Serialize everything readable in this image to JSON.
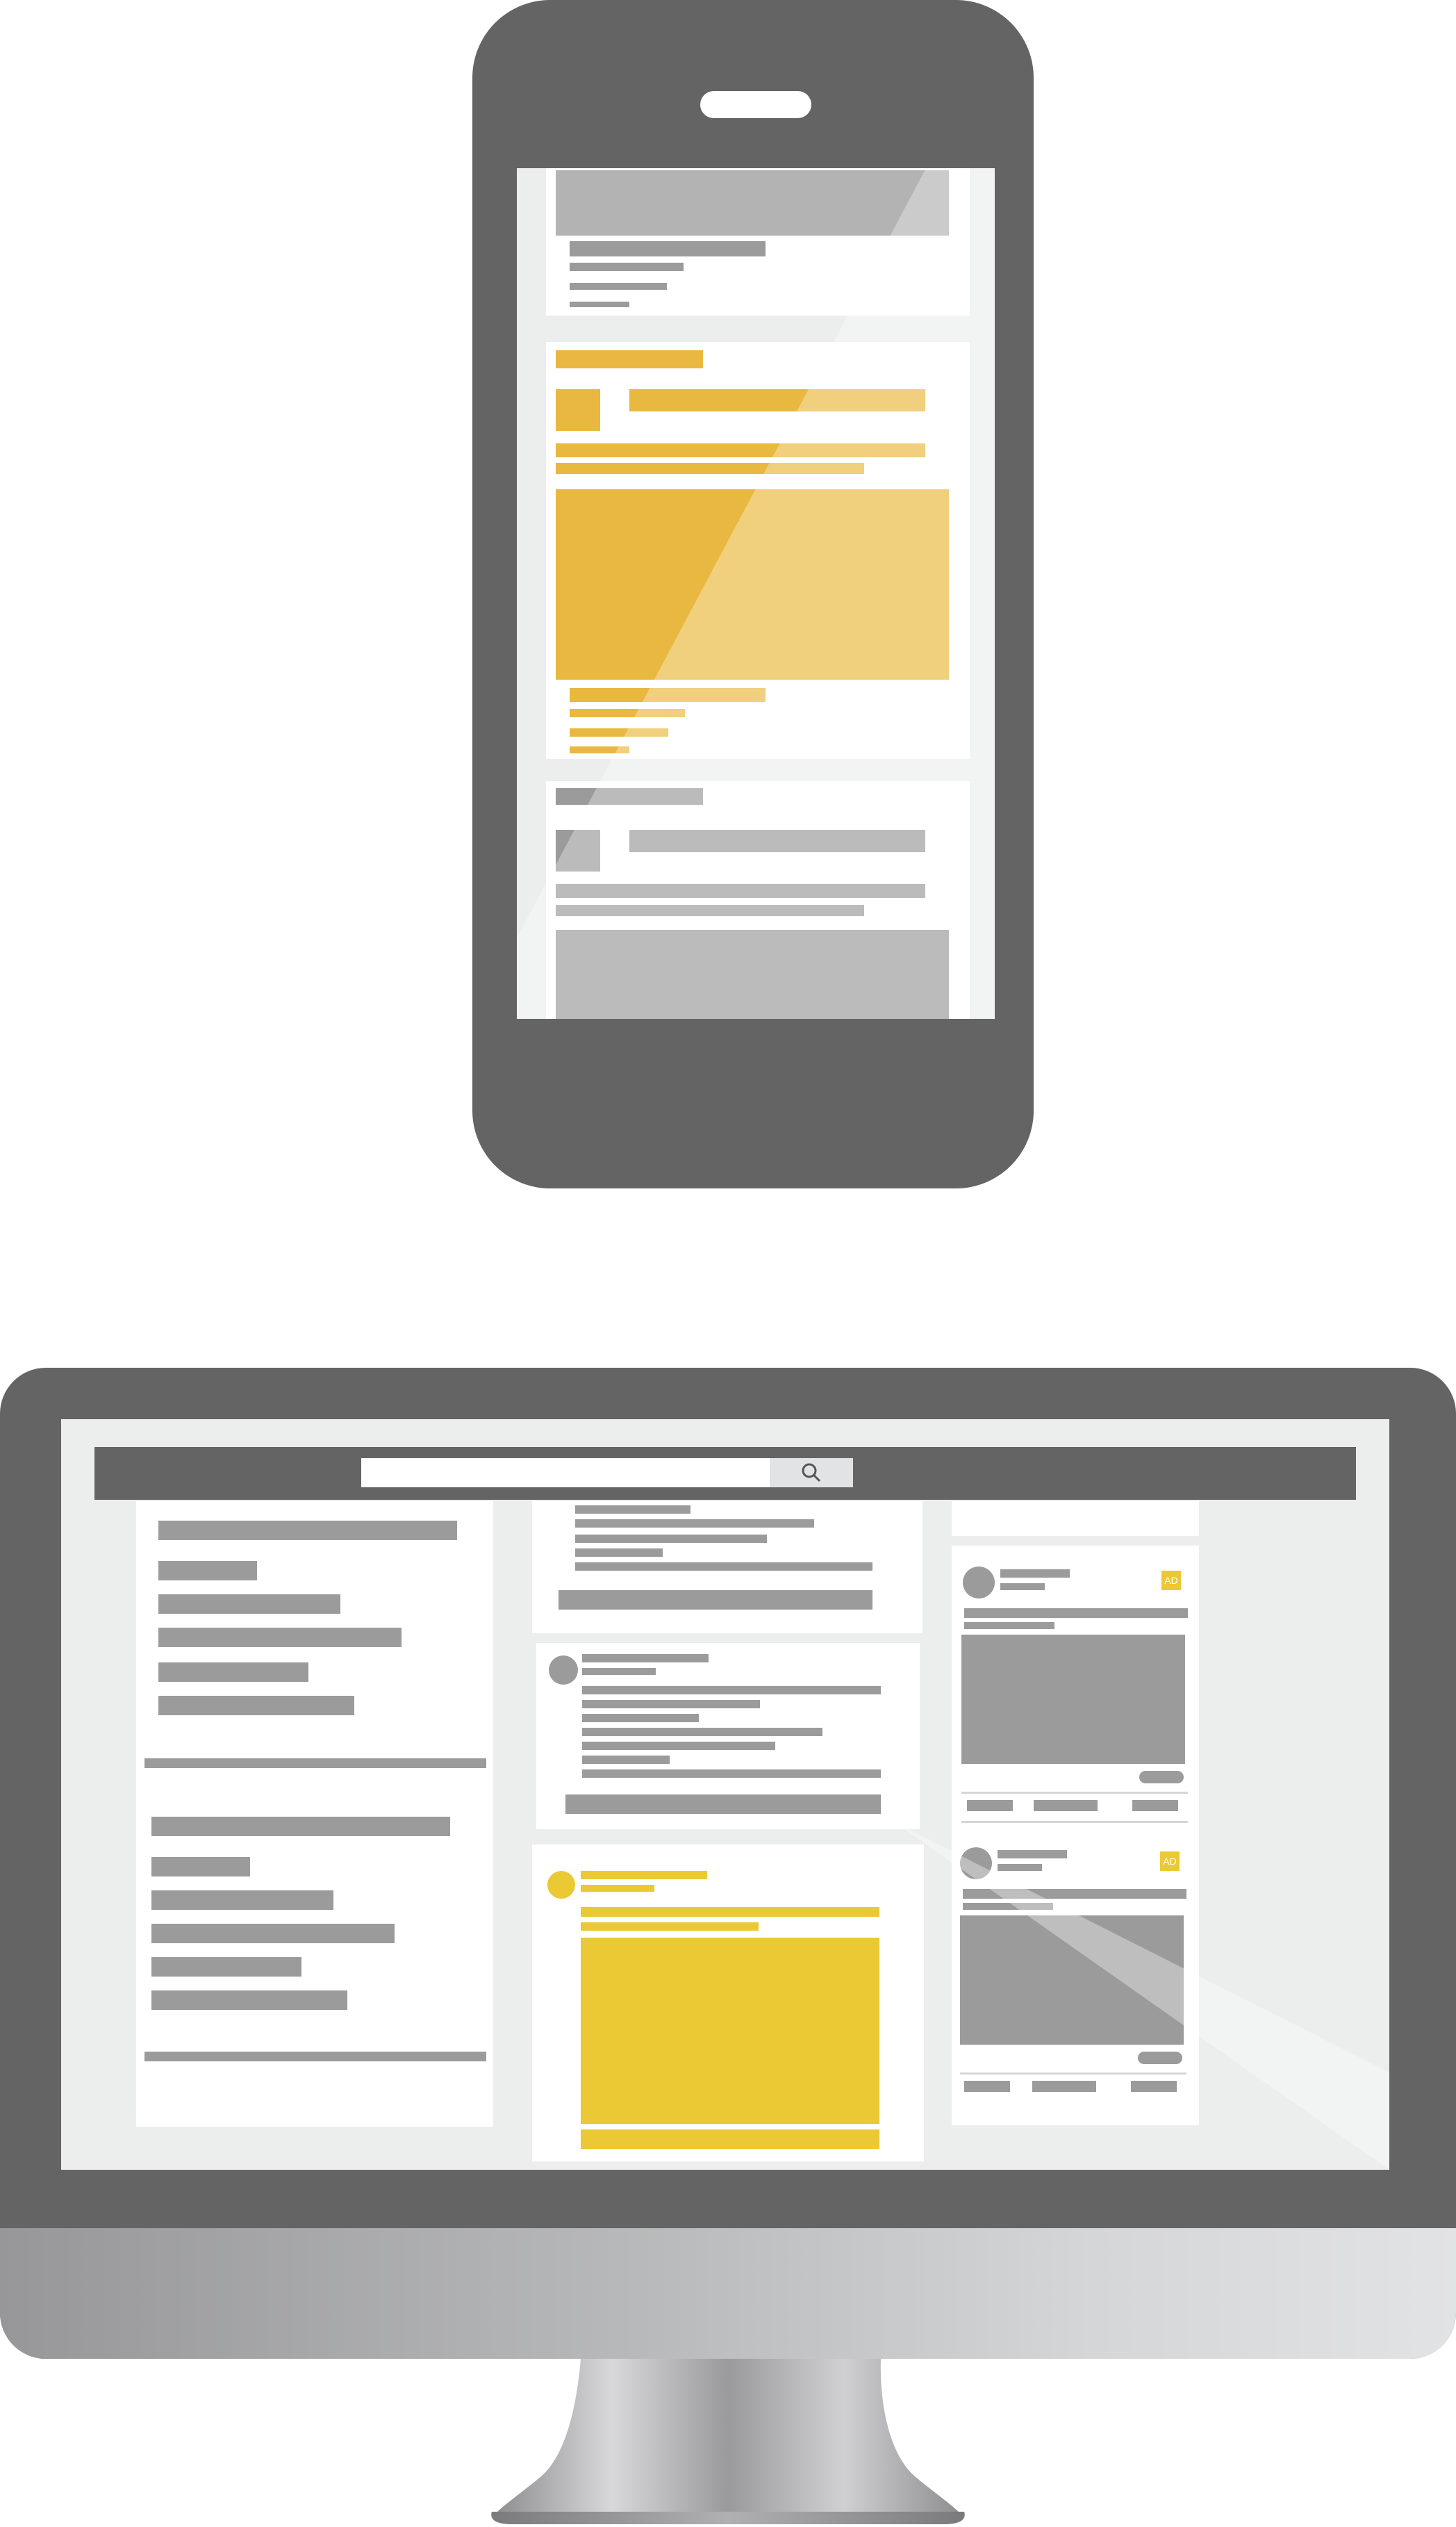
{
  "colors": {
    "device_frame": "#646464",
    "placeholder_gray": "#9b9b9b",
    "highlight_yellow": "#e9b840",
    "ad_yellow": "#ebc934",
    "screen_background": "#eceeee"
  },
  "search": {
    "placeholder": "",
    "icon": "search-icon"
  },
  "ads": [
    {
      "badge": "AD"
    },
    {
      "badge": "AD"
    }
  ]
}
